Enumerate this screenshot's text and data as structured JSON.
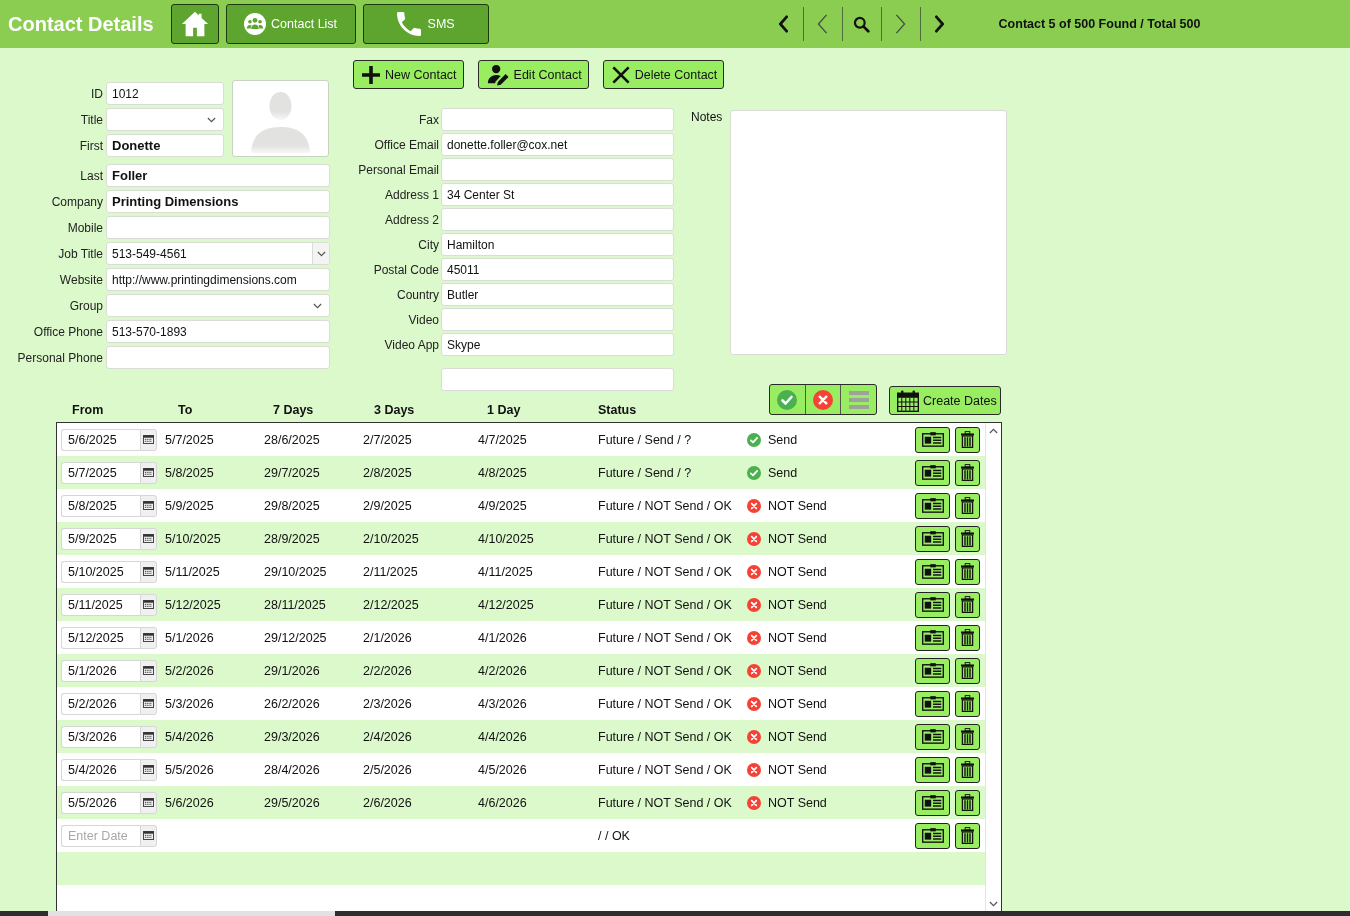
{
  "header": {
    "title": "Contact Details",
    "nav_buttons": [
      {
        "kind": "home"
      },
      {
        "kind": "contacts",
        "label": "Contact List"
      },
      {
        "kind": "phone",
        "label": "SMS"
      }
    ],
    "record_nav": [
      {
        "kind": "first"
      },
      {
        "kind": "previous"
      },
      {
        "kind": "search"
      },
      {
        "kind": "next"
      },
      {
        "kind": "last"
      }
    ],
    "record_status": "Contact 5 of 500 Found / Total 500"
  },
  "actions": [
    {
      "kind": "add",
      "label": "New Contact"
    },
    {
      "kind": "edit",
      "label": "Edit Contact"
    },
    {
      "kind": "delete",
      "label": "Delete Contact"
    }
  ],
  "contact_fields": [
    {
      "kind": "text",
      "label": "ID",
      "value": "1012",
      "bold": false
    },
    {
      "kind": "select",
      "label": "Title"
    },
    {
      "kind": "text",
      "label": "First",
      "value": "Donette",
      "bold": true
    },
    {
      "kind": "text",
      "label": "Last",
      "value": "Foller",
      "bold": true
    },
    {
      "kind": "text",
      "label": "Company",
      "value": "Printing Dimensions",
      "bold": true
    },
    {
      "kind": "text",
      "label": "Mobile"
    },
    {
      "kind": "combo",
      "label": "Job Title",
      "value": "513-549-4561",
      "bold": false
    },
    {
      "kind": "text",
      "label": "Website",
      "value": "http://www.printingdimensions.com",
      "bold": false
    },
    {
      "kind": "select",
      "label": "Group"
    },
    {
      "kind": "text",
      "label": "Office Phone",
      "value": "513-570-1893",
      "bold": false
    },
    {
      "kind": "text",
      "label": "Personal Phone"
    }
  ],
  "address_fields": [
    {
      "kind": "text",
      "label": "Fax"
    },
    {
      "kind": "text",
      "label": "Office Email",
      "value": "donette.foller@cox.net"
    },
    {
      "kind": "text",
      "label": "Personal Email"
    },
    {
      "kind": "text",
      "label": "Address 1",
      "value": "34 Center St"
    },
    {
      "kind": "text",
      "label": "Address 2"
    },
    {
      "kind": "text",
      "label": "City",
      "value": "Hamilton"
    },
    {
      "kind": "text",
      "label": "Postal Code",
      "value": "45011"
    },
    {
      "kind": "text",
      "label": "Country",
      "value": "Butler"
    },
    {
      "kind": "text",
      "label": "Video"
    },
    {
      "kind": "text",
      "label": "Video App",
      "value": "Skype"
    },
    {
      "kind": "text"
    }
  ],
  "notes": {
    "label": "Notes"
  },
  "schedule": {
    "filters": [
      {
        "kind": "sent"
      },
      {
        "kind": "not_sent"
      },
      {
        "kind": "all"
      }
    ],
    "create_button": "Create Dates",
    "columns": [
      "From",
      "To",
      "7 Days",
      "3 Days",
      "1 Day",
      "Status"
    ],
    "rows": [
      {
        "from": "5/6/2025",
        "to": "5/7/2025",
        "days_7": "28/6/2025",
        "days_3": "2/7/2025",
        "day_1": "4/7/2025",
        "status": "Future / Send / ?",
        "send": {
          "kind": "yes",
          "label": "Send"
        }
      },
      {
        "from": "5/7/2025",
        "to": "5/8/2025",
        "days_7": "29/7/2025",
        "days_3": "2/8/2025",
        "day_1": "4/8/2025",
        "status": "Future / Send / ?",
        "send": {
          "kind": "yes",
          "label": "Send"
        }
      },
      {
        "from": "5/8/2025",
        "to": "5/9/2025",
        "days_7": "29/8/2025",
        "days_3": "2/9/2025",
        "day_1": "4/9/2025",
        "status": "Future / NOT Send / OK",
        "send": {
          "kind": "no",
          "label": "NOT Send"
        }
      },
      {
        "from": "5/9/2025",
        "to": "5/10/2025",
        "days_7": "28/9/2025",
        "days_3": "2/10/2025",
        "day_1": "4/10/2025",
        "status": "Future / NOT Send / OK",
        "send": {
          "kind": "no",
          "label": "NOT Send"
        }
      },
      {
        "from": "5/10/2025",
        "to": "5/11/2025",
        "days_7": "29/10/2025",
        "days_3": "2/11/2025",
        "day_1": "4/11/2025",
        "status": "Future / NOT Send / OK",
        "send": {
          "kind": "no",
          "label": "NOT Send"
        }
      },
      {
        "from": "5/11/2025",
        "to": "5/12/2025",
        "days_7": "28/11/2025",
        "days_3": "2/12/2025",
        "day_1": "4/12/2025",
        "status": "Future / NOT Send / OK",
        "send": {
          "kind": "no",
          "label": "NOT Send"
        }
      },
      {
        "from": "5/12/2025",
        "to": "5/1/2026",
        "days_7": "29/12/2025",
        "days_3": "2/1/2026",
        "day_1": "4/1/2026",
        "status": "Future / NOT Send / OK",
        "send": {
          "kind": "no",
          "label": "NOT Send"
        }
      },
      {
        "from": "5/1/2026",
        "to": "5/2/2026",
        "days_7": "29/1/2026",
        "days_3": "2/2/2026",
        "day_1": "4/2/2026",
        "status": "Future / NOT Send / OK",
        "send": {
          "kind": "no",
          "label": "NOT Send"
        }
      },
      {
        "from": "5/2/2026",
        "to": "5/3/2026",
        "days_7": "26/2/2026",
        "days_3": "2/3/2026",
        "day_1": "4/3/2026",
        "status": "Future / NOT Send / OK",
        "send": {
          "kind": "no",
          "label": "NOT Send"
        }
      },
      {
        "from": "5/3/2026",
        "to": "5/4/2026",
        "days_7": "29/3/2026",
        "days_3": "2/4/2026",
        "day_1": "4/4/2026",
        "status": "Future / NOT Send / OK",
        "send": {
          "kind": "no",
          "label": "NOT Send"
        }
      },
      {
        "from": "5/4/2026",
        "to": "5/5/2026",
        "days_7": "28/4/2026",
        "days_3": "2/5/2026",
        "day_1": "4/5/2026",
        "status": "Future / NOT Send / OK",
        "send": {
          "kind": "no",
          "label": "NOT Send"
        }
      },
      {
        "from": "5/5/2026",
        "to": "5/6/2026",
        "days_7": "29/5/2026",
        "days_3": "2/6/2026",
        "day_1": "4/6/2026",
        "status": "Future / NOT Send / OK",
        "send": {
          "kind": "no",
          "label": "NOT Send"
        }
      },
      {
        "placeholder": "Enter Date",
        "status": "/ / OK"
      }
    ]
  }
}
